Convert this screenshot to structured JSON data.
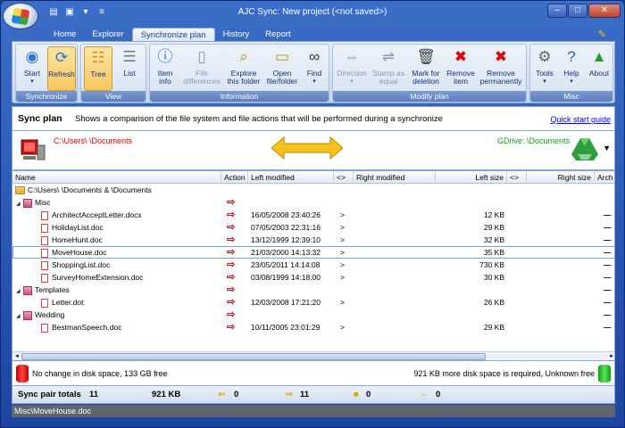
{
  "window": {
    "title": "AJC Sync:  New project (<not saved>)",
    "qat": [
      "folder-icon",
      "save-icon",
      "dropdown-icon",
      "customize-icon"
    ]
  },
  "tabs": [
    {
      "label": "Home",
      "active": false
    },
    {
      "label": "Explorer",
      "active": false
    },
    {
      "label": "Synchronize plan",
      "active": true
    },
    {
      "label": "History",
      "active": false
    },
    {
      "label": "Report",
      "active": false
    }
  ],
  "ribbon": {
    "groups": {
      "synchronize": "Synchronize",
      "view": "View",
      "information": "Information",
      "modify_plan": "Modify plan",
      "misc": "Misc"
    },
    "start": "Start",
    "refresh": "Refresh",
    "tree": "Tree",
    "list": "List",
    "item_info": [
      "Item",
      "info"
    ],
    "file_differences": [
      "File",
      "differences"
    ],
    "explore_folder": [
      "Explore",
      "this folder"
    ],
    "open_file": [
      "Open",
      "file/folder"
    ],
    "find": "Find",
    "direction": "Direction",
    "stamp_equal": [
      "Stamp as",
      "equal"
    ],
    "mark_deletion": [
      "Mark for",
      "deletion"
    ],
    "remove_item": [
      "Remove",
      "item"
    ],
    "remove_permanently": [
      "Remove",
      "permanently"
    ],
    "tools": "Tools",
    "help": "Help",
    "about": "About"
  },
  "syncplan": {
    "title": "Sync plan",
    "description": "Shows a comparison of the file system and file actions that will be performed during a synchronize",
    "quick_start": "Quick start guide"
  },
  "paths": {
    "left": "C:\\Users\\        \\Documents",
    "right": "GDrive:                               \\Documents"
  },
  "columns": {
    "name": "Name",
    "action": "Action",
    "left_modified": "Left modified",
    "cmp1": "<>",
    "right_modified": "Right modified",
    "left_size": "Left size",
    "cmp2": "<>",
    "right_size": "Right size",
    "arch": "Arch"
  },
  "rows": [
    {
      "type": "root",
      "name": "C:\\Users\\          \\Documents & \\Documents",
      "action": "",
      "modified": "",
      "cmp": "",
      "size": "",
      "end": ""
    },
    {
      "type": "folder",
      "name": "Misc",
      "action": "⇨",
      "modified": "",
      "cmp": "",
      "size": "",
      "end": ""
    },
    {
      "type": "file",
      "name": "ArchitectAcceptLetter.docx",
      "action": "⇨",
      "modified": "16/05/2008 23:40:26",
      "cmp": ">",
      "size": "12 KB",
      "end": "—"
    },
    {
      "type": "file",
      "name": "HolidayList.doc",
      "action": "⇨",
      "modified": "07/05/2003 22:31:16",
      "cmp": ">",
      "size": "29 KB",
      "end": "—"
    },
    {
      "type": "file",
      "name": "HomeHunt.doc",
      "action": "⇨",
      "modified": "13/12/1999 12:39:10",
      "cmp": ">",
      "size": "32 KB",
      "end": "—"
    },
    {
      "type": "file",
      "name": "MoveHouse.doc",
      "action": "⇨",
      "modified": "21/03/2000 14:13:32",
      "cmp": ">",
      "size": "35 KB",
      "end": "—",
      "selected": true
    },
    {
      "type": "file",
      "name": "ShoppingList.doc",
      "action": "⇨",
      "modified": "23/05/2011 14:14:08",
      "cmp": ">",
      "size": "730 KB",
      "end": "—"
    },
    {
      "type": "file",
      "name": "SurveyHomeExtension.doc",
      "action": "⇨",
      "modified": "03/08/1999 14:18:00",
      "cmp": ">",
      "size": "30 KB",
      "end": "—"
    },
    {
      "type": "folder",
      "name": "Templates",
      "action": "⇨",
      "modified": "",
      "cmp": "",
      "size": "",
      "end": "—"
    },
    {
      "type": "file",
      "name": "Letter.dot",
      "action": "⇨",
      "modified": "12/03/2008 17:21:20",
      "cmp": ">",
      "size": "26 KB",
      "end": "—"
    },
    {
      "type": "folder",
      "name": "Wedding",
      "action": "⇨",
      "modified": "",
      "cmp": "",
      "size": "",
      "end": "—"
    },
    {
      "type": "file",
      "name": "BestmanSpeech.doc",
      "action": "⇨",
      "modified": "10/11/2005 23:01:29",
      "cmp": ">",
      "size": "29 KB",
      "end": "—"
    }
  ],
  "disk": {
    "left": "No change in disk space, 133 GB free",
    "right": "921 KB more disk space is required, Unknown free"
  },
  "totals": {
    "label": "Sync pair totals",
    "count": "11",
    "size": "921 KB",
    "left_arrows": "0",
    "right_arrows": "11",
    "folders": "0",
    "both": "0"
  },
  "status": "Misc\\MoveHouse.doc",
  "colors": {
    "accent": "#15428b",
    "left_path": "#e00000",
    "right_path": "#1a9a1a"
  }
}
